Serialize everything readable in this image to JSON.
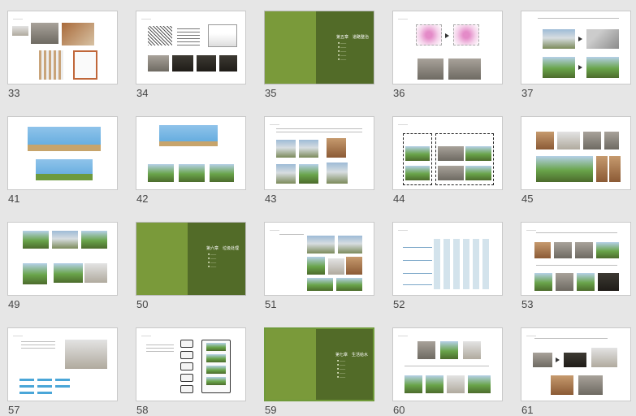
{
  "slides": [
    {
      "number": "33"
    },
    {
      "number": "34"
    },
    {
      "number": "35"
    },
    {
      "number": "36"
    },
    {
      "number": "37"
    },
    {
      "number": "41"
    },
    {
      "number": "42"
    },
    {
      "number": "43"
    },
    {
      "number": "44"
    },
    {
      "number": "45"
    },
    {
      "number": "49"
    },
    {
      "number": "50"
    },
    {
      "number": "51"
    },
    {
      "number": "52"
    },
    {
      "number": "53"
    },
    {
      "number": "57"
    },
    {
      "number": "58"
    },
    {
      "number": "59"
    },
    {
      "number": "60"
    },
    {
      "number": "61"
    }
  ],
  "chapters": {
    "s35": {
      "title": "第五章　道路整治"
    },
    "s50": {
      "title": "第六章　垃圾处理"
    },
    "s59": {
      "title": "第七章　生活给水"
    }
  },
  "colors": {
    "background": "#e6e6e6",
    "chapter_green_light": "#7a9a3a",
    "chapter_green_dark": "#526b28"
  }
}
